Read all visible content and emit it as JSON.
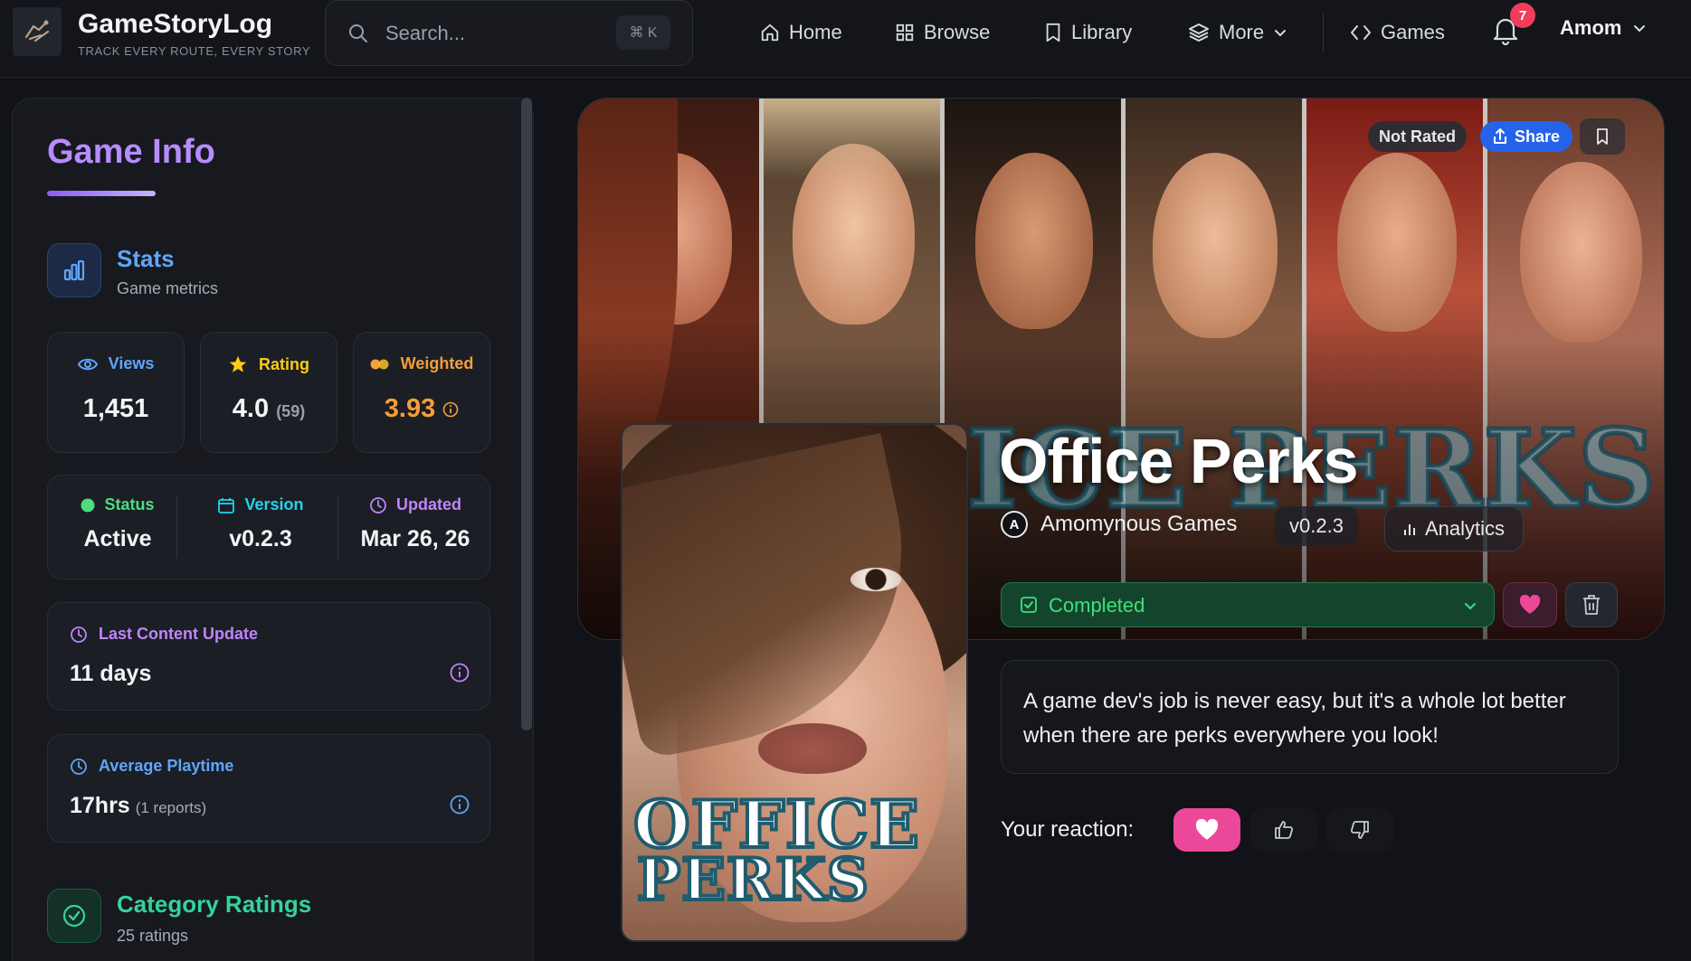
{
  "brand": {
    "name": "GameStoryLog",
    "tagline": "TRACK EVERY ROUTE, EVERY STORY"
  },
  "search": {
    "placeholder": "Search...",
    "shortcut": "⌘ K"
  },
  "nav": {
    "home": "Home",
    "browse": "Browse",
    "library": "Library",
    "more": "More",
    "games": "Games",
    "notifications_count": "7",
    "user": "Amom"
  },
  "sidebar": {
    "title": "Game Info",
    "stats": {
      "title": "Stats",
      "subtitle": "Game metrics"
    },
    "views": {
      "label": "Views",
      "value": "1,451"
    },
    "rating": {
      "label": "Rating",
      "value": "4.0",
      "count": "(59)"
    },
    "weighted": {
      "label": "Weighted",
      "value": "3.93"
    },
    "status": {
      "label": "Status",
      "value": "Active"
    },
    "version": {
      "label": "Version",
      "value": "v0.2.3"
    },
    "updated": {
      "label": "Updated",
      "value": "Mar 26, 26"
    },
    "last_content": {
      "label": "Last Content Update",
      "value": "11 days"
    },
    "playtime": {
      "label": "Average Playtime",
      "value": "17hrs",
      "reports": "(1 reports)"
    },
    "category": {
      "title": "Category Ratings",
      "subtitle": "25 ratings"
    }
  },
  "game": {
    "title": "Office Perks",
    "developer": "Amomynous Games",
    "developer_initial": "A",
    "version": "v0.2.3",
    "analytics_label": "Analytics",
    "rated_badge": "Not Rated",
    "share_label": "Share",
    "status_selected": "Completed",
    "description": "A game dev's job is never easy, but it's a whole lot better when there are perks everywhere you look!",
    "reaction_label": "Your reaction:",
    "cover_logo_line1": "OFFICE",
    "cover_logo_line2": "PERKS",
    "hero_logo_text": "ICE PERKS"
  },
  "colors": {
    "accent_purple": "#b68cff",
    "stats_blue": "#60a5fa",
    "status_green": "#3ee07e",
    "weighted_orange": "#f59e3b",
    "rating_yellow": "#facc15",
    "favorite_pink": "#ec4899",
    "share_blue": "#2563eb"
  },
  "icons": [
    "logo-icon",
    "search-icon",
    "home-icon",
    "grid-icon",
    "bookmark-icon",
    "layers-icon",
    "chevron-down-icon",
    "code-icon",
    "bell-icon",
    "bar-chart-icon",
    "eye-icon",
    "star-icon",
    "weighted-icon",
    "info-icon",
    "calendar-icon",
    "clock-icon",
    "check-circle-icon",
    "share-icon",
    "heart-icon",
    "trash-icon",
    "thumbs-up-icon",
    "thumbs-down-icon",
    "check-square-icon"
  ]
}
